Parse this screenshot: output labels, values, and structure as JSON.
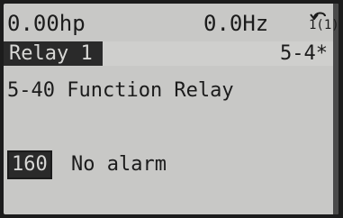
{
  "status": {
    "power": "0.00hp",
    "frequency": "0.0Hz",
    "setup_number": "1(1)"
  },
  "header": {
    "group_title": "Relay 1",
    "group_code": "5-4*"
  },
  "parameter": {
    "title": "5-40 Function Relay",
    "value_code": "160",
    "value_text": "No alarm"
  }
}
